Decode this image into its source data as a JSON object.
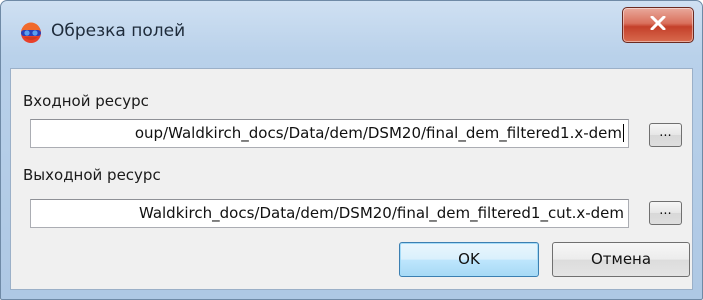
{
  "window": {
    "title": "Обрезка полей",
    "icon": "app-logo-icon",
    "close_icon": "close-icon"
  },
  "input": {
    "label": "Входной ресурс",
    "value": "oup/Waldkirch_docs/Data/dem/DSM20/final_dem_filtered1.x-dem",
    "browse_label": "..."
  },
  "output": {
    "label": "Выходной ресурс",
    "value": "Waldkirch_docs/Data/dem/DSM20/final_dem_filtered1_cut.x-dem",
    "browse_label": "..."
  },
  "buttons": {
    "ok": "OK",
    "cancel": "Отмена"
  },
  "colors": {
    "frame": "#b9d1ea",
    "close_button": "#c4402a",
    "default_button_border": "#3c7fb1"
  }
}
